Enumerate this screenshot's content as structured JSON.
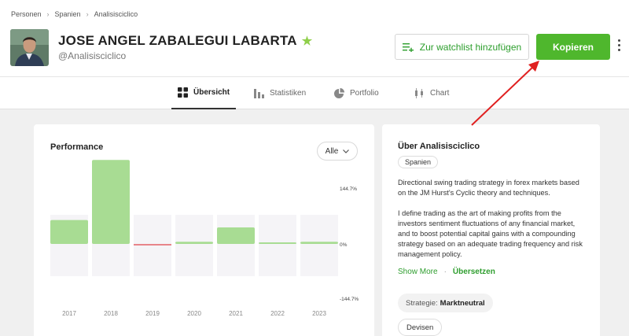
{
  "breadcrumb": [
    "Personen",
    "Spanien",
    "Analisisciclico"
  ],
  "profile": {
    "name": "JOSE ANGEL ZABALEGUI LABARTA",
    "handle": "@Analisisciclico"
  },
  "actions": {
    "watchlist_label": "Zur watchlist hinzufügen",
    "copy_label": "Kopieren"
  },
  "tabs": [
    {
      "label": "Übersicht",
      "icon": "grid-icon",
      "active": true
    },
    {
      "label": "Statistiken",
      "icon": "bar-chart-icon",
      "active": false
    },
    {
      "label": "Portfolio",
      "icon": "pie-chart-icon",
      "active": false
    },
    {
      "label": "Chart",
      "icon": "candlestick-icon",
      "active": false
    }
  ],
  "performance": {
    "title": "Performance",
    "range_label": "Alle"
  },
  "chart_data": {
    "type": "bar",
    "categories": [
      "2017",
      "2018",
      "2019",
      "2020",
      "2021",
      "2022",
      "2023"
    ],
    "values": [
      55,
      193,
      -5,
      5,
      38,
      2,
      5
    ],
    "y_tick_labels": [
      "144.7%",
      "0%",
      "-144.7%"
    ],
    "ylim": [
      -144.7,
      144.7
    ],
    "colors": {
      "positive": "#a8dc93",
      "negative": "#e8848a",
      "track": "#f5f4f7"
    }
  },
  "about": {
    "title": "Über Analisisciclico",
    "country": "Spanien",
    "paragraph1": "Directional swing trading strategy in forex markets based on the JM Hurst's Cyclic theory and techniques.",
    "paragraph2": "I define trading as the art of making profits from the investors sentiment fluctuations of any financial market, and to boost potential capital gains with a compounding strategy based on an adequate trading frequency and risk management policy.",
    "show_more": "Show More",
    "translate": "Übersetzen",
    "strategy_label": "Strategie:",
    "strategy_value": "Marktneutral",
    "tag": "Devisen"
  },
  "colors": {
    "brand_green": "#4fb72d",
    "annotation_arrow": "#e02020"
  }
}
